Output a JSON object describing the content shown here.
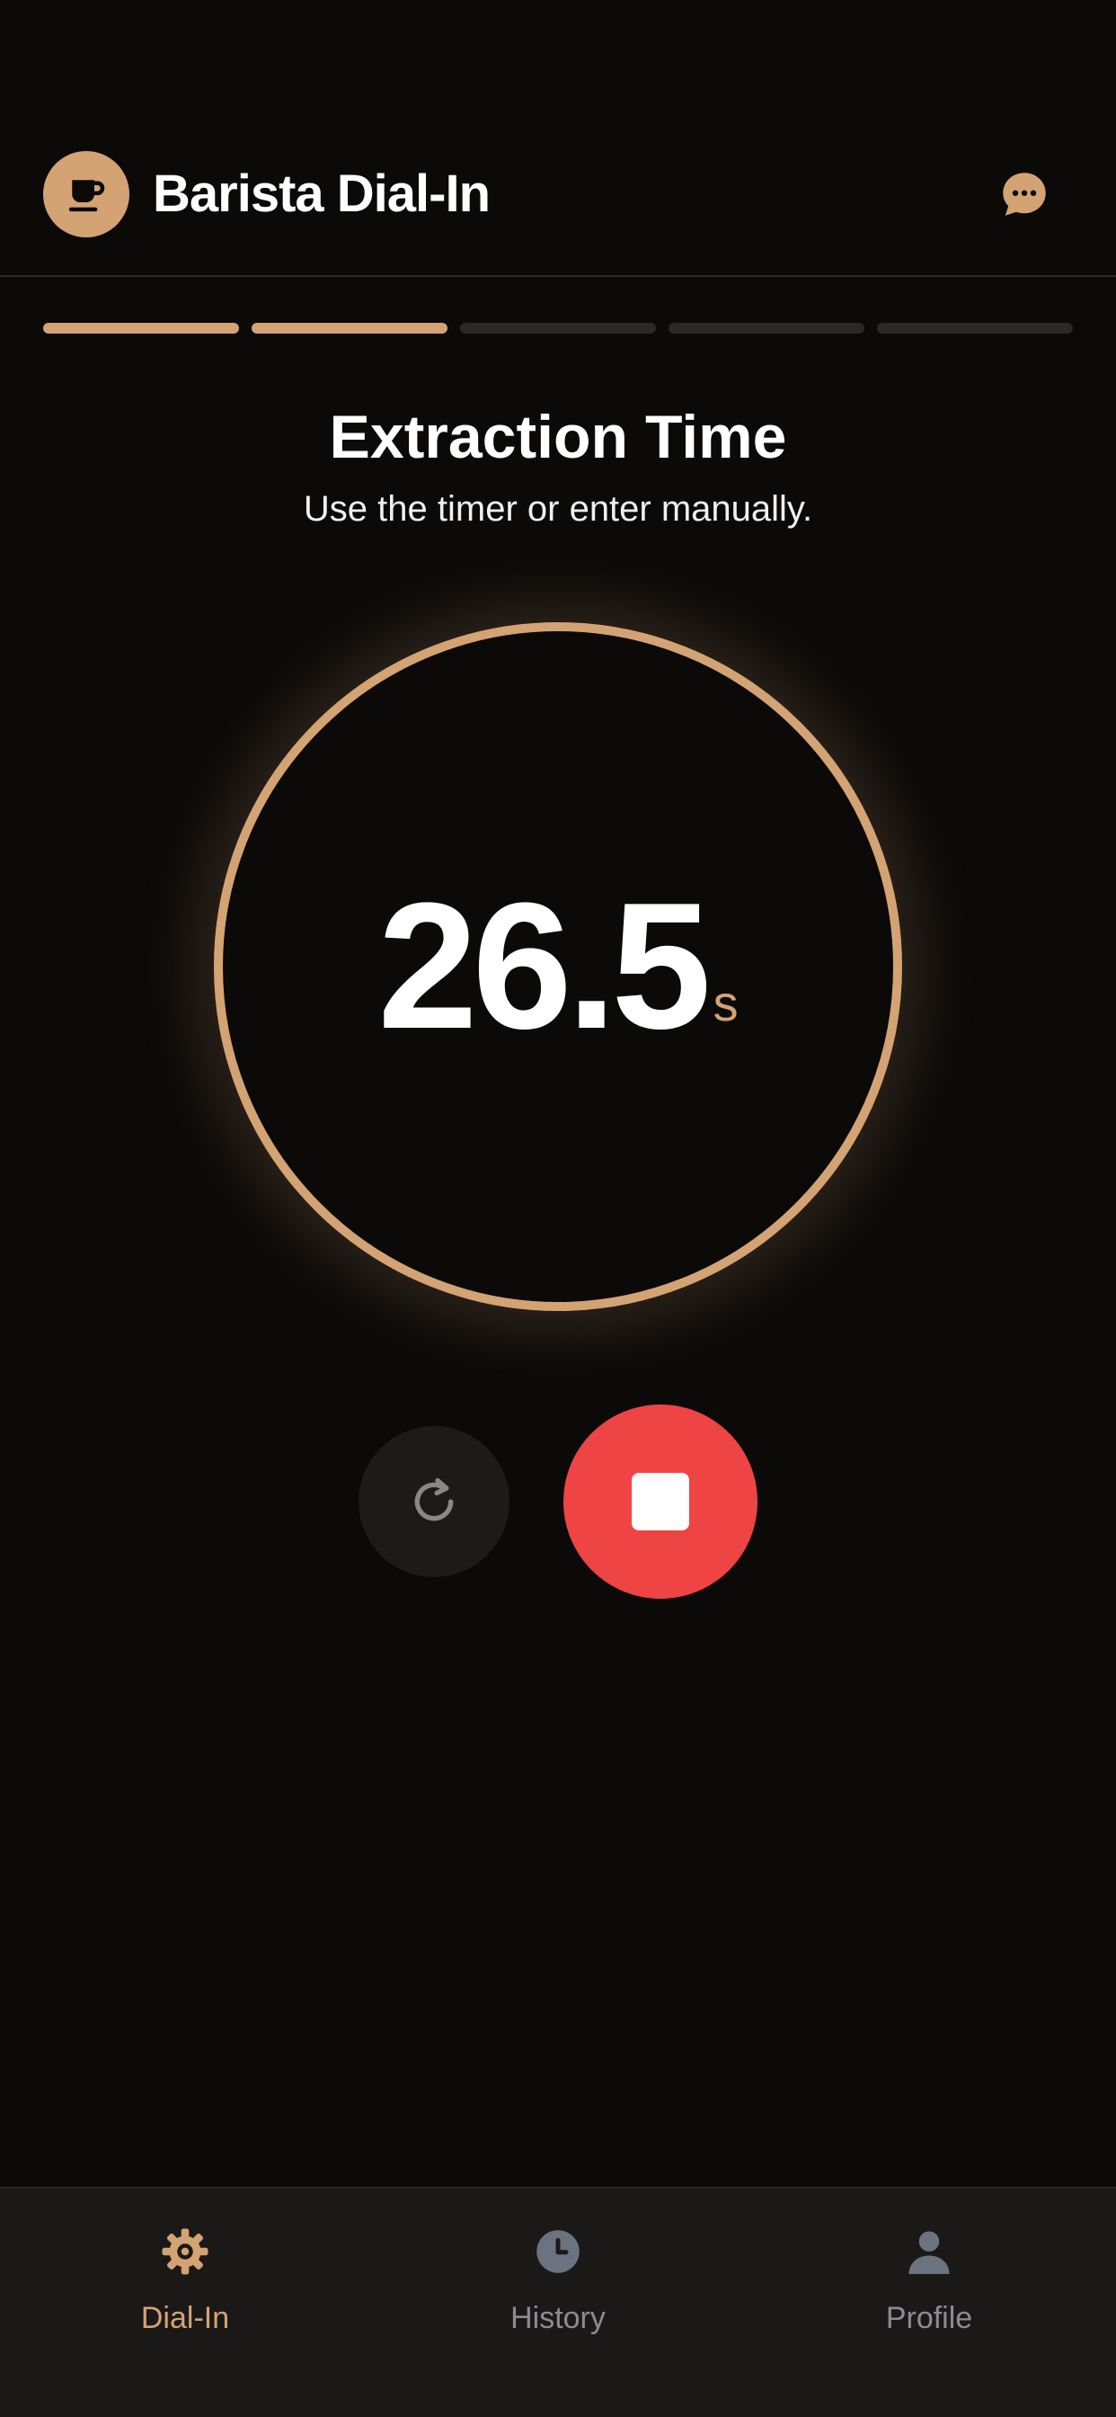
{
  "header": {
    "title": "Barista Dial-In",
    "logo_icon": "coffee-cup-icon",
    "action_icon": "chat-bubble-icon"
  },
  "progress": {
    "total_steps": 5,
    "completed_steps": 2
  },
  "step": {
    "title": "Extraction Time",
    "subtitle": "Use the timer or enter manually."
  },
  "timer": {
    "value": "26.5",
    "unit": "s"
  },
  "controls": {
    "reset_icon": "reset-icon",
    "stop_icon": "stop-icon"
  },
  "tabs": [
    {
      "label": "Dial-In",
      "icon": "gear-icon",
      "active": true
    },
    {
      "label": "History",
      "icon": "clock-icon",
      "active": false
    },
    {
      "label": "Profile",
      "icon": "person-icon",
      "active": false
    }
  ],
  "colors": {
    "background": "#0c0a09",
    "accent": "#d4a373",
    "stop": "#ef4444",
    "inactive": "#8c8b93",
    "track": "#2b2826"
  }
}
